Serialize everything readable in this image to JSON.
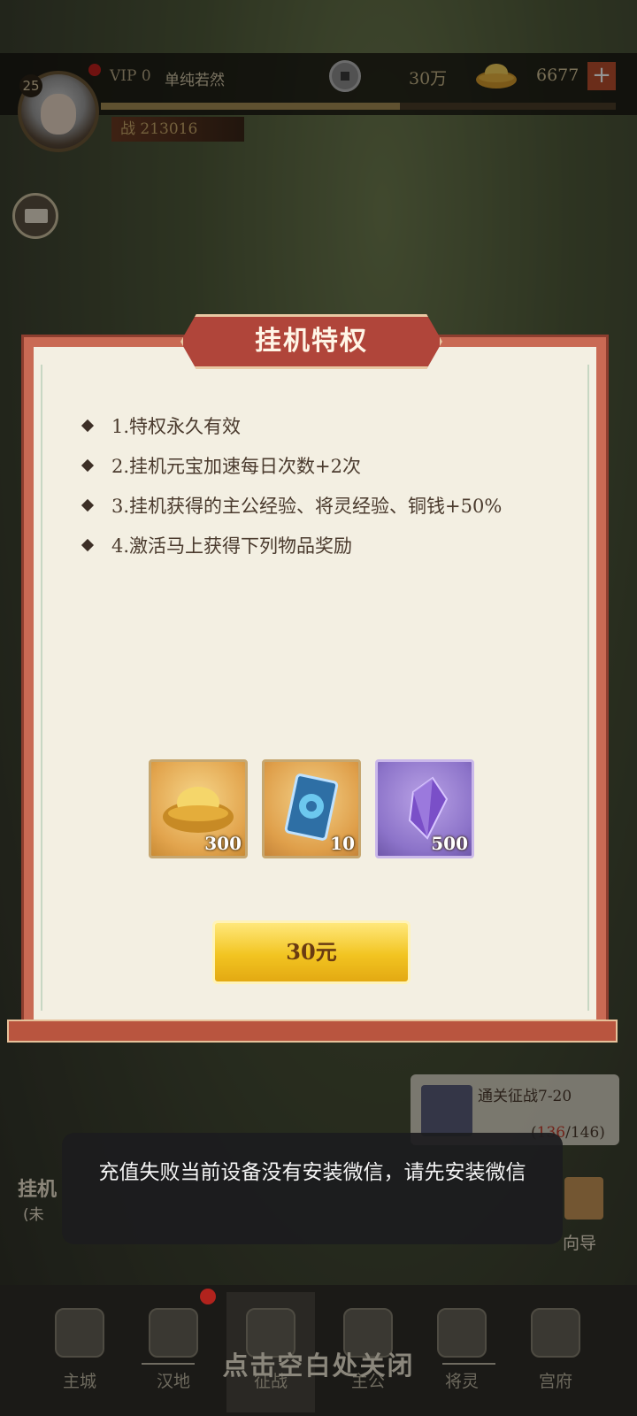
{
  "header": {
    "level": "25",
    "vip": "VIP 0",
    "player_name": "单纯若然",
    "copper_amount": "30万",
    "gold_amount": "6677",
    "power_label": "战 213016",
    "exp_progress": 0.58
  },
  "modal": {
    "title": "挂机特权",
    "bullets": [
      "1.特权永久有效",
      "2.挂机元宝加速每日次数+2次",
      "3.挂机获得的主公经验、将灵经验、铜钱+50%",
      "4.激活马上获得下列物品奖励"
    ],
    "rewards": [
      {
        "icon": "gold-ingot-icon",
        "qty": "300"
      },
      {
        "icon": "blue-card-icon",
        "qty": "10"
      },
      {
        "icon": "purple-crystal-icon",
        "qty": "500"
      }
    ],
    "buy_label": "30元"
  },
  "background": {
    "afk_label": "挂机",
    "afk_sub": "(未",
    "quest_title": "通关征战7-20",
    "quest_current": "136",
    "quest_total": "/146)",
    "quest_open": "(",
    "guide_label": "向导"
  },
  "toast": {
    "message": "充值失败当前设备没有安装微信，请先安装微信"
  },
  "bottom_nav": {
    "items": [
      {
        "label": "主城",
        "icon": "city-icon"
      },
      {
        "label": "汉地",
        "icon": "territory-icon"
      },
      {
        "label": "征战",
        "icon": "crossed-swords-icon"
      },
      {
        "label": "主公",
        "icon": "lord-icon"
      },
      {
        "label": "将灵",
        "icon": "general-spirit-icon"
      },
      {
        "label": "宫府",
        "icon": "palace-icon"
      }
    ],
    "close_hint": "点击空白处关闭"
  },
  "colors": {
    "modal_frame": "#c96a54",
    "modal_paper": "#f3efe2",
    "button_gold": "#f2c421",
    "toast_bg": "#1c1c1e"
  }
}
